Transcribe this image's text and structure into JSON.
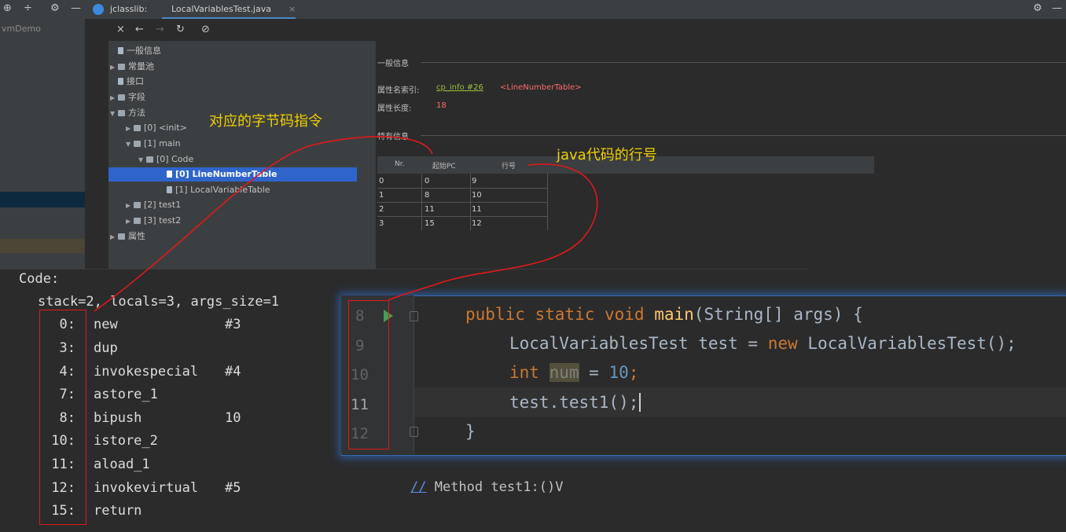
{
  "toolbar": {
    "left_icons": [
      "⊕",
      "÷",
      "⚙",
      "—"
    ],
    "tab_app": "jclasslib:",
    "tab_file": "LocalVariablesTest.java",
    "tab_close": "×",
    "right_icons": [
      "⚙",
      "—"
    ]
  },
  "project": {
    "name": "vmDemo"
  },
  "jclasslib_toolbar": [
    "×",
    "←",
    "→",
    "↻",
    "⊘"
  ],
  "tree": {
    "items": [
      {
        "label": "一般信息"
      },
      {
        "label": "常量池"
      },
      {
        "label": "接口"
      },
      {
        "label": "字段"
      },
      {
        "label": "方法"
      },
      {
        "label": "[0] <init>"
      },
      {
        "label": "[1] main"
      },
      {
        "label": "[0] Code"
      },
      {
        "label": "[0] LineNumberTable"
      },
      {
        "label": "[1] LocalVariableTable"
      },
      {
        "label": "[2] test1"
      },
      {
        "label": "[3] test2"
      },
      {
        "label": "属性"
      }
    ]
  },
  "info": {
    "general_header": "一般信息",
    "name_index_label": "属性名索引:",
    "name_index_link": "cp_info #26",
    "name_index_value": "<LineNumberTable>",
    "length_label": "属性长度:",
    "length_value": "18",
    "specific_header": "特有信息",
    "table": {
      "headers": [
        "Nr.",
        "起始PC",
        "行号"
      ],
      "rows": [
        [
          "0",
          "0",
          "9"
        ],
        [
          "1",
          "8",
          "10"
        ],
        [
          "2",
          "11",
          "11"
        ],
        [
          "3",
          "15",
          "12"
        ]
      ]
    }
  },
  "annotations": {
    "bytecode_note": "对应的字节码指令",
    "java_line_note": "java代码的行号"
  },
  "bytecode": {
    "header": "Code:",
    "stack_line": "stack=2, locals=3, args_size=1",
    "instructions": [
      {
        "pc": "0:",
        "op": "new",
        "arg": "#3"
      },
      {
        "pc": "3:",
        "op": "dup",
        "arg": ""
      },
      {
        "pc": "4:",
        "op": "invokespecial",
        "arg": "#4"
      },
      {
        "pc": "7:",
        "op": "astore_1",
        "arg": ""
      },
      {
        "pc": "8:",
        "op": "bipush",
        "arg": "10"
      },
      {
        "pc": "10:",
        "op": "istore_2",
        "arg": ""
      },
      {
        "pc": "11:",
        "op": "aload_1",
        "arg": ""
      },
      {
        "pc": "12:",
        "op": "invokevirtual",
        "arg": "#5"
      },
      {
        "pc": "15:",
        "op": "return",
        "arg": ""
      }
    ],
    "comment_slash": "//",
    "comment_text": " Method test1:()V"
  },
  "editor": {
    "line_numbers": [
      "8",
      "9",
      "10",
      "11",
      "12"
    ],
    "l8_kw": "public static void ",
    "l8_fn": "main",
    "l8_rest": "(String[] args) {",
    "l9_a": "LocalVariablesTest test = ",
    "l9_kw": "new",
    "l9_b": " LocalVariablesTest();",
    "l10_kw": "int",
    "l10_var": "num",
    "l10_eq": " = ",
    "l10_num": "10",
    "l10_end": ";",
    "l11": "test.test1();",
    "l12": "}"
  },
  "colors": {
    "accent_selection": "#2f65ca",
    "annotation_red": "#e0191b",
    "annotation_yellow": "#f0d000",
    "keyword": "#cc7832",
    "number": "#6897bb"
  }
}
